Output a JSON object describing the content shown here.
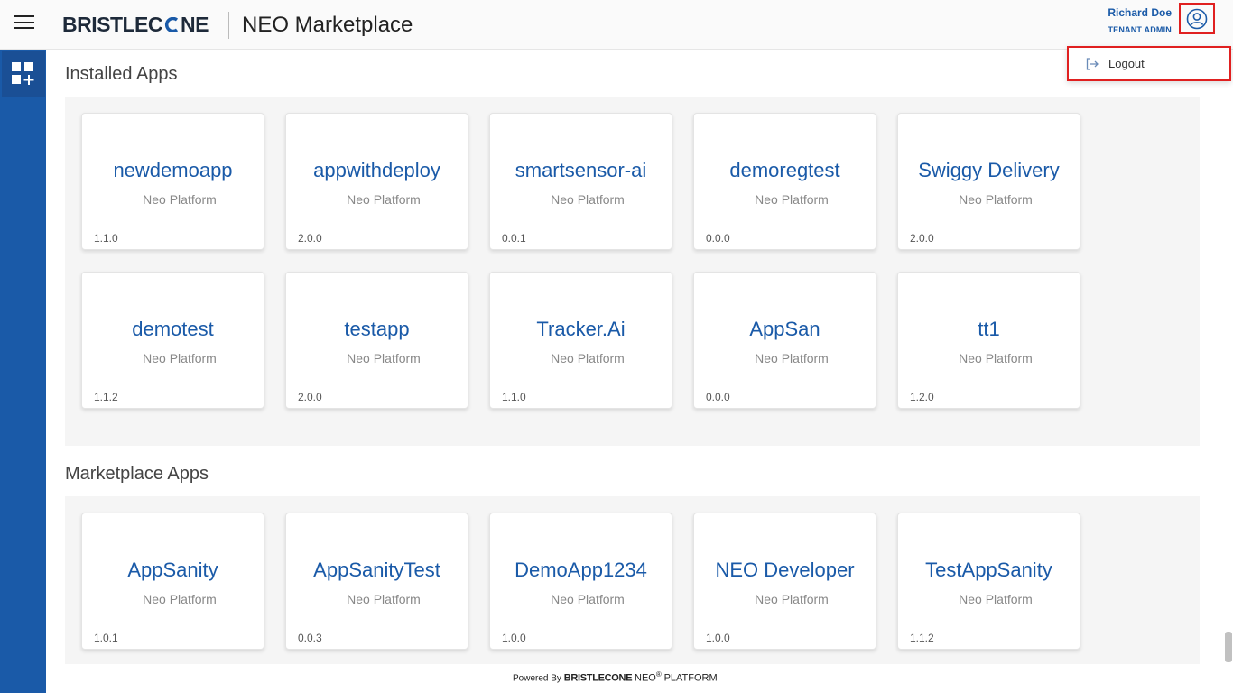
{
  "header": {
    "brand": "BRISTLECONE",
    "app_title": "NEO Marketplace",
    "user_name": "Richard Doe",
    "user_role": "TENANT ADMIN"
  },
  "dropdown": {
    "logout_label": "Logout"
  },
  "sections": {
    "installed_title": "Installed Apps",
    "marketplace_title": "Marketplace Apps"
  },
  "installed_apps": [
    {
      "name": "newdemoapp",
      "platform": "Neo Platform",
      "version": "1.1.0"
    },
    {
      "name": "appwithdeploy",
      "platform": "Neo Platform",
      "version": "2.0.0"
    },
    {
      "name": "smartsensor-ai",
      "platform": "Neo Platform",
      "version": "0.0.1"
    },
    {
      "name": "demoregtest",
      "platform": "Neo Platform",
      "version": "0.0.0"
    },
    {
      "name": "Swiggy Delivery",
      "platform": "Neo Platform",
      "version": "2.0.0"
    },
    {
      "name": "demotest",
      "platform": "Neo Platform",
      "version": "1.1.2"
    },
    {
      "name": "testapp",
      "platform": "Neo Platform",
      "version": "2.0.0"
    },
    {
      "name": "Tracker.Ai",
      "platform": "Neo Platform",
      "version": "1.1.0"
    },
    {
      "name": "AppSan",
      "platform": "Neo Platform",
      "version": "0.0.0"
    },
    {
      "name": "tt1",
      "platform": "Neo Platform",
      "version": "1.2.0"
    }
  ],
  "marketplace_apps": [
    {
      "name": "AppSanity",
      "platform": "Neo Platform",
      "version": "1.0.1"
    },
    {
      "name": "AppSanityTest",
      "platform": "Neo Platform",
      "version": "0.0.3"
    },
    {
      "name": "DemoApp1234",
      "platform": "Neo Platform",
      "version": "1.0.0"
    },
    {
      "name": "NEO Developer",
      "platform": "Neo Platform",
      "version": "1.0.0"
    },
    {
      "name": "TestAppSanity",
      "platform": "Neo Platform",
      "version": "1.1.2"
    }
  ],
  "footer": {
    "powered_by": "Powered By",
    "brand": "BRISTLECONE",
    "neo": "NEO",
    "reg": "®",
    "platform": "PLATFORM"
  },
  "icons": {
    "menu": "hamburger-menu-icon",
    "user": "user-account-icon",
    "logout": "logout-icon",
    "apps": "apps-grid-add-icon"
  },
  "colors": {
    "brand_blue": "#1a5aa8",
    "highlight_red": "#e02020",
    "panel_bg": "#f5f5f5"
  }
}
